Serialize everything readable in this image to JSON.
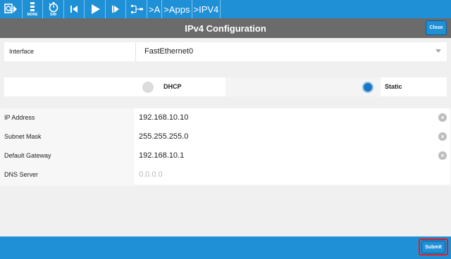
{
  "toolbar": {
    "more_label": "MORE",
    "sim_label": "SIM",
    "breadcrumb": [
      ">A",
      ">Apps",
      ">IPV4"
    ]
  },
  "header": {
    "title": "IPv4 Configuration",
    "close_label": "Close"
  },
  "interface": {
    "label": "Interface",
    "value": "FastEthernet0"
  },
  "ip_mode": {
    "options": [
      {
        "label": "DHCP",
        "selected": false
      },
      {
        "label": "Static",
        "selected": true
      }
    ]
  },
  "fields": {
    "ip_address": {
      "label": "IP Address",
      "value": "192.168.10.10"
    },
    "subnet_mask": {
      "label": "Subnet Mask",
      "value": "255.255.255.0"
    },
    "default_gateway": {
      "label": "Default Gateway",
      "value": "192.168.10.1"
    },
    "dns_server": {
      "label": "DNS Server",
      "placeholder": "0.0.0.0"
    }
  },
  "footer": {
    "submit_label": "Submit"
  },
  "colors": {
    "accent": "#1f8fd6",
    "titlebar": "#6b6b6b",
    "highlight": "#e21b1b",
    "radio_selected": "#1a76c2"
  }
}
